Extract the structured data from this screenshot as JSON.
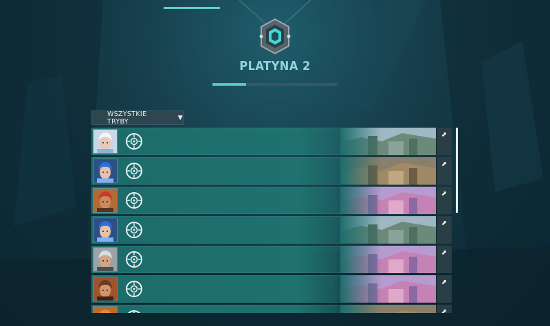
{
  "rank": {
    "title": "PLATYNA 2",
    "progress": 0.27,
    "emblem": "platinum-rank-icon"
  },
  "filter": {
    "label": "WSZYSTKIE TRYBY",
    "icon": "caret-down-icon"
  },
  "matches": [
    {
      "champion": "white-hair-champion",
      "map": "ascent-mountain-map",
      "result": "win"
    },
    {
      "champion": "blue-hair-champion",
      "map": "stone-ruins-map",
      "result": "win"
    },
    {
      "champion": "red-bandana-champion",
      "map": "pink-bazaar-map",
      "result": "win"
    },
    {
      "champion": "blue-hair-champion",
      "map": "ascent-mountain-map",
      "result": "win"
    },
    {
      "champion": "silver-hair-champion",
      "map": "pink-bazaar-map",
      "result": "win"
    },
    {
      "champion": "bearded-champion",
      "map": "pink-bazaar-map",
      "result": "win"
    },
    {
      "champion": "orange-champion",
      "map": "stone-ruins-map",
      "result": "win"
    }
  ],
  "colors": {
    "accent": "#5fd0cf",
    "row": "#1f7270",
    "title": "#8fd5e0"
  },
  "icons": {
    "role": "role-target-icon",
    "open": "open-details-icon"
  }
}
